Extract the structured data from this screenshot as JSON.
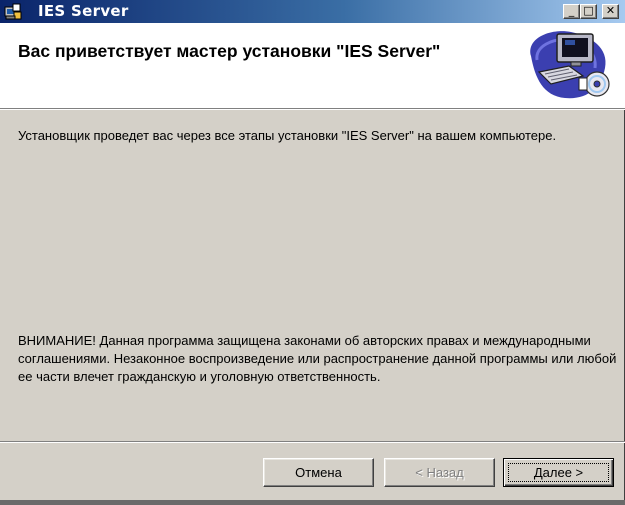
{
  "window": {
    "title": "IES Server",
    "controls": {
      "minimize": "_",
      "maximize": "□",
      "close": "✕"
    }
  },
  "header": {
    "title": "Вас приветствует мастер установки \"IES Server\"",
    "graphic_icon": "setup-computer-disc-icon"
  },
  "body": {
    "intro": "Установщик проведет вас через все этапы установки \"IES Server\" на вашем компьютере.",
    "warning": "ВНИМАНИЕ! Данная программа защищена законами об авторских правах и международными соглашениями. Незаконное воспроизведение или распространение данной программы или любой ее части влечет гражданскую и уголовную ответственность."
  },
  "buttons": {
    "cancel": "Отмена",
    "back": "< Назад",
    "next": "Далее >"
  },
  "colors": {
    "titlebar_start": "#0a246a",
    "titlebar_end": "#a6caf0",
    "face": "#d4d0c8",
    "header_bg": "#ffffff"
  }
}
